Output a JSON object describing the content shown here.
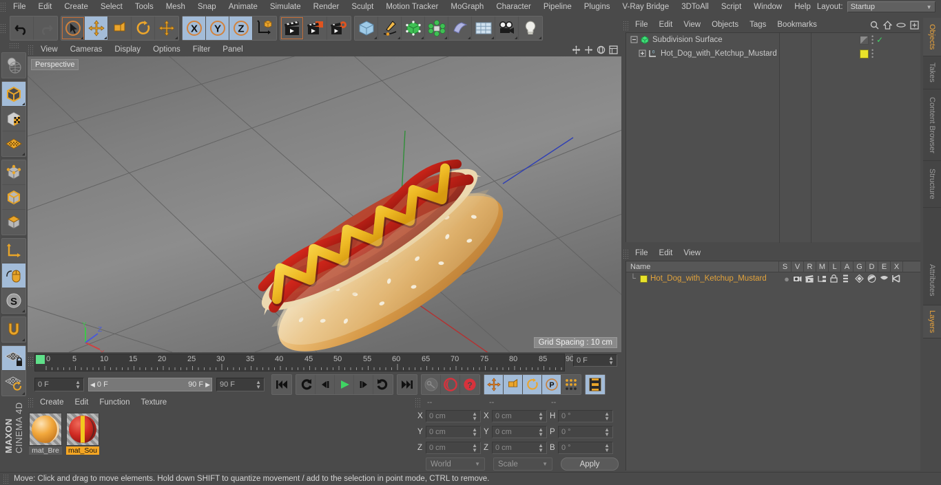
{
  "app": {
    "brand_top": "MAXON",
    "brand_bottom": "CINEMA 4D"
  },
  "menubar": {
    "items": [
      "File",
      "Edit",
      "Create",
      "Select",
      "Tools",
      "Mesh",
      "Snap",
      "Animate",
      "Simulate",
      "Render",
      "Sculpt",
      "Motion Tracker",
      "MoGraph",
      "Character",
      "Pipeline",
      "Plugins",
      "V-Ray Bridge",
      "3DToAll",
      "Script",
      "Window",
      "Help"
    ],
    "layout_label": "Layout:",
    "layout_value": "Startup",
    "search_icon": "search-icon"
  },
  "toolbar": {
    "groups": [
      {
        "name": "undo-redo",
        "buttons": [
          {
            "name": "undo-button",
            "icon": "undo-arrow-icon",
            "state": "normal"
          },
          {
            "name": "redo-button",
            "icon": "redo-arrow-icon",
            "state": "disabled"
          }
        ]
      },
      {
        "name": "transform-tools",
        "buttons": [
          {
            "name": "live-selection-tool",
            "icon": "cursor-circle-icon",
            "state": "selected"
          },
          {
            "name": "move-tool",
            "icon": "move-arrows-icon",
            "state": "active"
          },
          {
            "name": "scale-tool",
            "icon": "scale-box-icon",
            "state": "normal"
          },
          {
            "name": "rotate-tool",
            "icon": "rotate-circle-icon",
            "state": "normal"
          },
          {
            "name": "move-axis-tool",
            "icon": "move-arrows-icon",
            "state": "normal"
          }
        ]
      },
      {
        "name": "axis-locks",
        "buttons": [
          {
            "name": "x-axis-lock",
            "icon": "x-axis-icon",
            "label": "X",
            "state": "active"
          },
          {
            "name": "y-axis-lock",
            "icon": "y-axis-icon",
            "label": "Y",
            "state": "active"
          },
          {
            "name": "z-axis-lock",
            "icon": "z-axis-icon",
            "label": "Z",
            "state": "active"
          },
          {
            "name": "world-object-axis",
            "icon": "world-axis-cube-icon",
            "state": "normal"
          }
        ]
      },
      {
        "name": "render-tools",
        "buttons": [
          {
            "name": "render-view-button",
            "icon": "clapperboard-icon",
            "state": "selected"
          },
          {
            "name": "render-to-picture-viewer-button",
            "icon": "clapperboard-orange-icon",
            "state": "normal"
          },
          {
            "name": "render-settings-button",
            "icon": "clapperboard-gear-icon",
            "state": "normal"
          }
        ]
      },
      {
        "name": "create-objects",
        "buttons": [
          {
            "name": "add-cube-button",
            "icon": "blue-cube-icon",
            "state": "normal"
          },
          {
            "name": "add-spline-button",
            "icon": "pen-spline-icon",
            "state": "normal"
          },
          {
            "name": "nurbs-generator-button",
            "icon": "green-cube-points-icon",
            "state": "normal"
          },
          {
            "name": "array-modeling-button",
            "icon": "green-cluster-icon",
            "state": "normal"
          },
          {
            "name": "deformer-button",
            "icon": "bend-deformer-icon",
            "state": "normal"
          },
          {
            "name": "scene-floor-button",
            "icon": "grid-floor-icon",
            "state": "normal"
          },
          {
            "name": "add-camera-button",
            "icon": "camera-icon",
            "state": "normal"
          },
          {
            "name": "add-light-button",
            "icon": "lightbulb-icon",
            "state": "normal"
          }
        ]
      }
    ]
  },
  "left_toolbar": {
    "buttons": [
      {
        "name": "make-editable-button",
        "icon": "globe-wire-icon",
        "state": "normal"
      },
      {
        "name": "model-mode-button",
        "icon": "orange-cube-icon",
        "state": "active"
      },
      {
        "name": "texture-mode-button",
        "icon": "checker-cube-icon",
        "state": "normal"
      },
      {
        "name": "axis-mode-button",
        "icon": "orange-mesh-plane-icon",
        "state": "normal"
      },
      {
        "name": "points-mode-button",
        "icon": "cube-points-icon",
        "state": "normal"
      },
      {
        "name": "edges-mode-button",
        "icon": "cube-edges-icon",
        "state": "normal"
      },
      {
        "name": "polygons-mode-button",
        "icon": "cube-polygons-icon",
        "state": "normal"
      },
      {
        "name": "world-coordinates-button",
        "icon": "axis-corner-icon",
        "state": "normal"
      },
      {
        "name": "viewport-solo-button",
        "icon": "mouse-orange-icon",
        "state": "active"
      },
      {
        "name": "soft-selection-button",
        "icon": "s-sphere-icon",
        "state": "active"
      },
      {
        "name": "magnet-tool-button",
        "icon": "magnet-icon",
        "state": "normal"
      },
      {
        "name": "workplane-lock-button",
        "icon": "plane-lock-icon",
        "state": "active"
      },
      {
        "name": "workplane-rotate-button",
        "icon": "plane-rotate-icon",
        "state": "normal"
      }
    ]
  },
  "viewport": {
    "menu": [
      "View",
      "Cameras",
      "Display",
      "Options",
      "Filter",
      "Panel"
    ],
    "label": "Perspective",
    "grid_spacing": "Grid Spacing : 10 cm",
    "axis_gizmo": {
      "x": "X",
      "y": "Y",
      "z": "Z",
      "x_color": "#d04040",
      "y_color": "#3ec64a",
      "z_color": "#4a5ad8"
    },
    "scene_object": "hot-dog-with-ketchup-and-mustard",
    "tool_icons": [
      "move-view-icon",
      "pan-view-icon",
      "rotate-view-icon",
      "maximize-view-icon"
    ]
  },
  "timeline": {
    "ticks": [
      0,
      5,
      10,
      15,
      20,
      25,
      30,
      35,
      40,
      45,
      50,
      55,
      60,
      65,
      70,
      75,
      80,
      85,
      90
    ],
    "tick_min": 0,
    "tick_max": 90,
    "current_frame_marker": 0,
    "frame_field_right": "0 F",
    "current_frame": "0 F",
    "range_start": "0 F",
    "range_end": "90 F",
    "max_frame": "90 F",
    "transport": [
      {
        "name": "go-to-start-button",
        "icon": "skip-start-icon"
      },
      {
        "name": "previous-key-button",
        "icon": "rewind-key-icon"
      },
      {
        "name": "step-back-button",
        "icon": "step-back-icon"
      },
      {
        "name": "play-button",
        "icon": "play-icon"
      },
      {
        "name": "step-forward-button",
        "icon": "step-forward-icon"
      },
      {
        "name": "next-key-button",
        "icon": "forward-key-icon"
      },
      {
        "name": "go-to-end-button",
        "icon": "skip-end-icon"
      }
    ],
    "record_group": [
      {
        "name": "record-active-objects-button",
        "icon": "key-grey-icon",
        "state": "disabled"
      },
      {
        "name": "autokeying-button",
        "icon": "red-circle-icon",
        "state": "normal"
      },
      {
        "name": "keyframe-selection-button",
        "icon": "red-question-icon",
        "state": "normal"
      }
    ],
    "key_toggles": [
      {
        "name": "position-key-button",
        "icon": "move-arrows-icon",
        "state": "active"
      },
      {
        "name": "scale-key-button",
        "icon": "scale-box-icon",
        "state": "active"
      },
      {
        "name": "rotation-key-button",
        "icon": "rotate-circle-icon",
        "state": "active"
      },
      {
        "name": "parameter-key-button",
        "icon": "p-circle-icon",
        "state": "active"
      },
      {
        "name": "point-level-animation-button",
        "icon": "dot-matrix-icon",
        "state": "normal"
      },
      {
        "name": "timeline-toggle-button",
        "icon": "filmstrip-icon",
        "state": "active"
      }
    ]
  },
  "material_manager": {
    "menu": [
      "Create",
      "Edit",
      "Function",
      "Texture"
    ],
    "materials": [
      {
        "name": "mat_Bre",
        "selected": false,
        "color_a": "#f0a030",
        "color_b": "#f6e3c0"
      },
      {
        "name": "mat_Sou",
        "selected": true,
        "color_a": "#d02626",
        "color_b": "#f2c81e"
      }
    ]
  },
  "coordinates": {
    "headers": [
      "--",
      "--",
      "--"
    ],
    "position": {
      "label_x": "X",
      "label_y": "Y",
      "label_z": "Z",
      "x": "0 cm",
      "y": "0 cm",
      "z": "0 cm"
    },
    "size": {
      "label_x": "X",
      "label_y": "Y",
      "label_z": "Z",
      "x": "0 cm",
      "y": "0 cm",
      "z": "0 cm"
    },
    "rotation": {
      "label_h": "H",
      "label_p": "P",
      "label_b": "B",
      "h": "0 °",
      "p": "0 °",
      "b": "0 °"
    },
    "coord_system": "World",
    "size_mode": "Scale",
    "apply_label": "Apply"
  },
  "object_manager": {
    "menu": [
      "File",
      "Edit",
      "View",
      "Objects",
      "Tags",
      "Bookmarks"
    ],
    "header_icons": [
      "search-icon",
      "home-icon",
      "eye-icon",
      "expand-icon"
    ],
    "rows": [
      {
        "name": "Subdivision Surface",
        "depth": 0,
        "icon": "subdivision-surface-icon",
        "tag_color": "#6a6a6a",
        "visible_check": "✓"
      },
      {
        "name": "Hot_Dog_with_Ketchup_Mustard",
        "depth": 1,
        "icon": "polygon-object-icon",
        "tag_color": "#e9e32a",
        "visible_check": ""
      }
    ]
  },
  "layer_manager": {
    "menu": [
      "File",
      "Edit",
      "View"
    ],
    "columns": [
      "Name",
      "S",
      "V",
      "R",
      "M",
      "L",
      "A",
      "G",
      "D",
      "E",
      "X"
    ],
    "rows": [
      {
        "name": "Hot_Dog_with_Ketchup_Mustard",
        "swatch": "#e9e32a",
        "flags": [
          "solo-dot",
          "visible-eye",
          "render-clapper",
          "manager-icon",
          "lock-icon",
          "animation-icon",
          "generator-icon",
          "deformer-icon",
          "expression-icon",
          "xref-icon"
        ]
      }
    ]
  },
  "side_tabs": {
    "top": [
      {
        "label": "Objects",
        "active": true
      },
      {
        "label": "Takes",
        "active": false
      },
      {
        "label": "Content Browser",
        "active": false
      },
      {
        "label": "Structure",
        "active": false
      }
    ],
    "bottom": [
      {
        "label": "Attributes",
        "active": false
      },
      {
        "label": "Layers",
        "active": true
      }
    ]
  },
  "status_bar": {
    "message": "Move: Click and drag to move elements. Hold down SHIFT to quantize movement / add to the selection in point mode, CTRL to remove."
  },
  "colors": {
    "panel_bg": "#4a4a4a",
    "button_bg": "#5a5a5a",
    "active_blue": "#a3bcd8",
    "accent_orange": "#e8a33d",
    "selected_orange": "#f5a623",
    "text": "#c8c8c8"
  }
}
